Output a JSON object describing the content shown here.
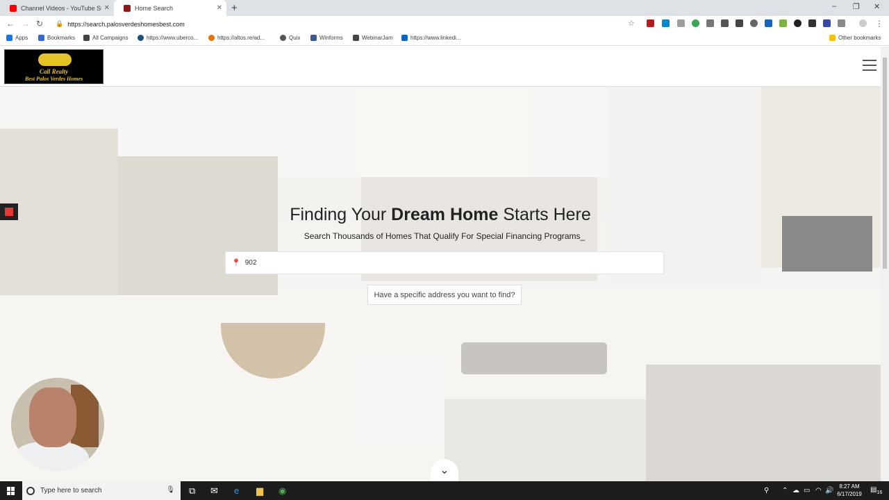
{
  "browser": {
    "tabs": [
      {
        "title": "Channel Videos - YouTube Studio",
        "active": false,
        "favicon_color": "#ff0000"
      },
      {
        "title": "Home Search",
        "active": true,
        "favicon_color": "#8b1a1a"
      }
    ],
    "url": "https://search.palosverdeshomesbest.com",
    "bookmarks": [
      {
        "label": "Apps",
        "icon_color": "#1a73e8"
      },
      {
        "label": "Bookmarks",
        "icon_color": "#3367d6"
      },
      {
        "label": "All Campaigns",
        "icon_color": "#444444"
      },
      {
        "label": "https://www.uberco...",
        "icon_color": "#1f4e79"
      },
      {
        "label": "https://altos.re/ad...",
        "icon_color": "#e37400"
      },
      {
        "label": "Quix",
        "icon_color": "#555555"
      },
      {
        "label": "Winforms",
        "icon_color": "#3b5998"
      },
      {
        "label": "WebinarJam",
        "icon_color": "#444444"
      },
      {
        "label": "https://www.linkedi...",
        "icon_color": "#0a66c2"
      },
      {
        "label": "Other bookmarks",
        "icon_color": "#f4c20d"
      }
    ]
  },
  "site": {
    "logo": {
      "line1": "Call Realty",
      "line2": "Best Palos Verdes Homes"
    },
    "hero": {
      "headline_pre": "Finding Your ",
      "headline_bold": "Dream Home",
      "headline_post": " Starts Here",
      "subheadline": "Search Thousands of Homes That Qualify For Special Financing Programs_",
      "search_value": "902",
      "address_button": "Have a specific address you want to find?"
    }
  },
  "taskbar": {
    "search_placeholder": "Type here to search",
    "time": "8:27 AM",
    "date": "6/17/2019",
    "notification_count": "16"
  }
}
